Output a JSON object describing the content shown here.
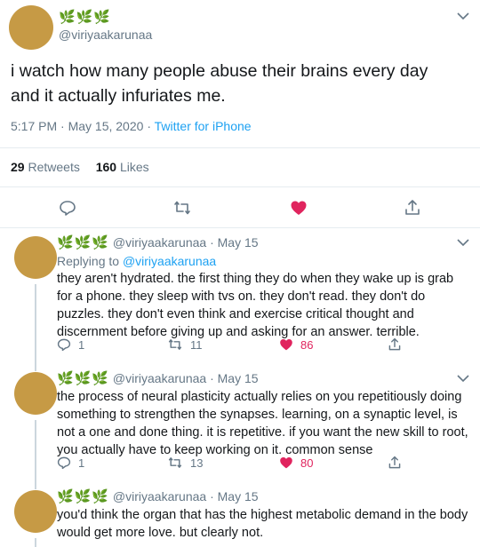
{
  "main_tweet": {
    "display_name": "🌿🌿🌿",
    "handle": "@viriyaakarunaa",
    "text": "i watch how many people abuse their brains every day and it actually infuriates me.",
    "time": "5:17 PM · May 15, 2020",
    "separator": "·",
    "client": "Twitter for iPhone",
    "retweets_count": "29",
    "retweets_label": "Retweets",
    "likes_count": "160",
    "likes_label": "Likes"
  },
  "replies": [
    {
      "display_name": "🌿🌿🌿",
      "handle": "@viriyaakarunaa",
      "date": "· May 15",
      "replying_to_label": "Replying to",
      "replying_to_handle": "@viriyaakarunaa",
      "text": "they aren't hydrated. the first thing they do when they wake up is grab for a phone. they sleep with tvs on. they don't read. they don't do puzzles. they don't even think and exercise critical thought and discernment before giving up and asking for an answer. terrible.",
      "reply_count": "1",
      "retweet_count": "11",
      "like_count": "86"
    },
    {
      "display_name": "🌿🌿🌿",
      "handle": "@viriyaakarunaa",
      "date": "· May 15",
      "text": "the process of neural plasticity actually relies on you repetitiously doing something to strengthen the synapses. learning, on a synaptic level, is not a one and done thing. it is repetitive. if you want the new skill to root, you actually have to keep working on it. common sense",
      "reply_count": "1",
      "retweet_count": "13",
      "like_count": "80"
    },
    {
      "display_name": "🌿🌿🌿",
      "handle": "@viriyaakarunaa",
      "date": "· May 15",
      "text": "you'd think the organ that has the highest metabolic demand in the body would get more love. but clearly not."
    }
  ],
  "colors": {
    "accent": "#1da1f2",
    "like": "#e0245e",
    "herb": "#4c9a3a",
    "avatar": "#c69a45"
  }
}
